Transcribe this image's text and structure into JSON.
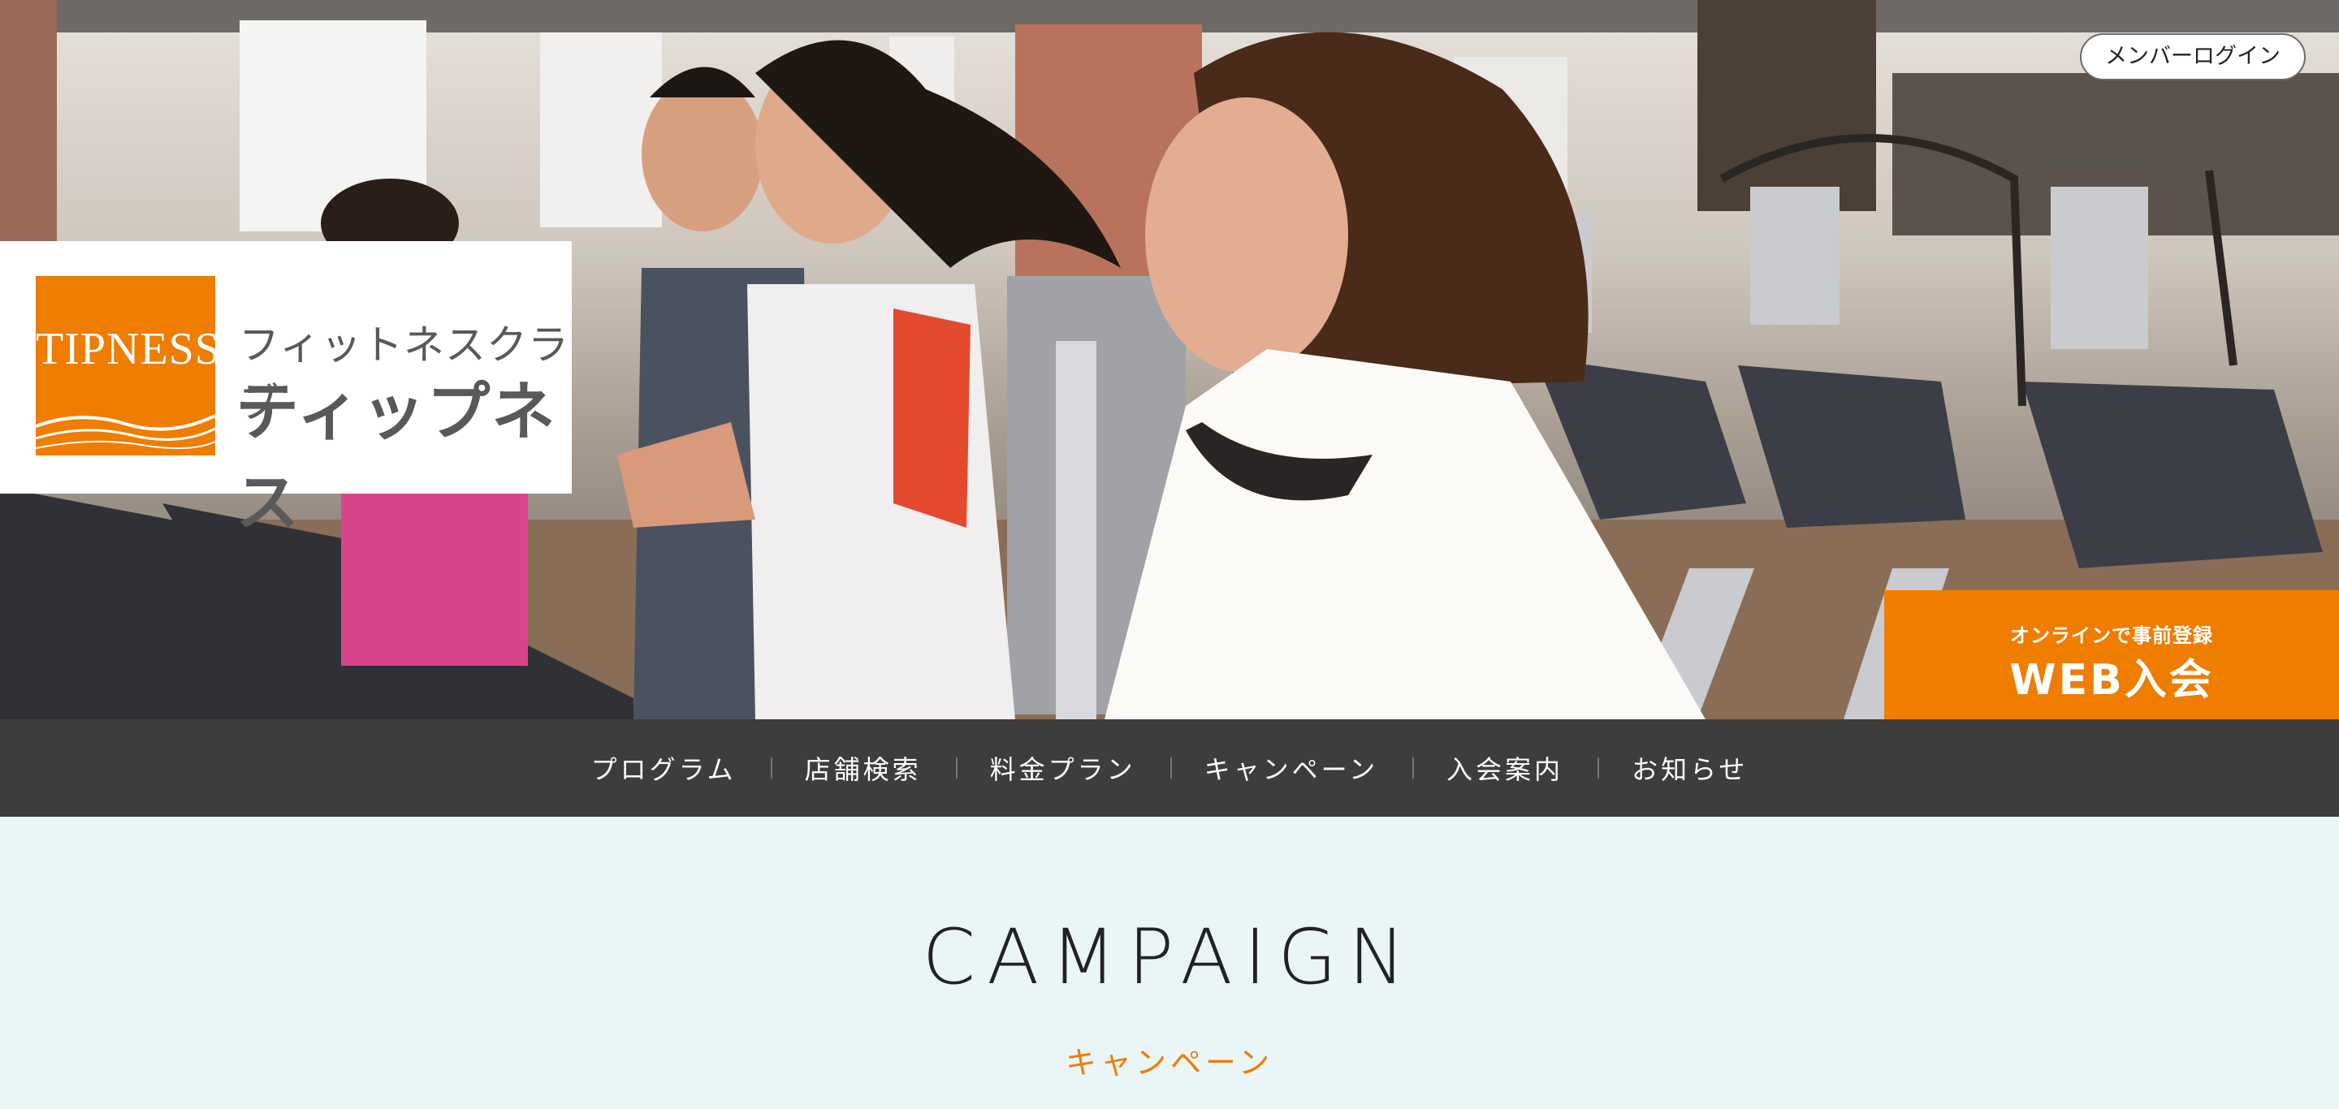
{
  "header": {
    "login_label": "メンバーログイン",
    "logo": {
      "mark_text": "TIPNESS",
      "line1": "フィットネスクラブ",
      "line2": "ティップネス"
    },
    "web_join": {
      "sub_label": "オンラインで事前登録",
      "main_label": "WEB入会"
    }
  },
  "nav": {
    "items": [
      {
        "label": "プログラム"
      },
      {
        "label": "店舗検索"
      },
      {
        "label": "料金プラン"
      },
      {
        "label": "キャンペーン"
      },
      {
        "label": "入会案内"
      },
      {
        "label": "お知らせ"
      }
    ]
  },
  "section": {
    "title": "CAMPAIGN",
    "subtitle": "キャンペーン"
  },
  "colors": {
    "accent": "#ee7d00",
    "nav_bg": "#3d3d3d",
    "section_bg": "#eaf5f7"
  }
}
